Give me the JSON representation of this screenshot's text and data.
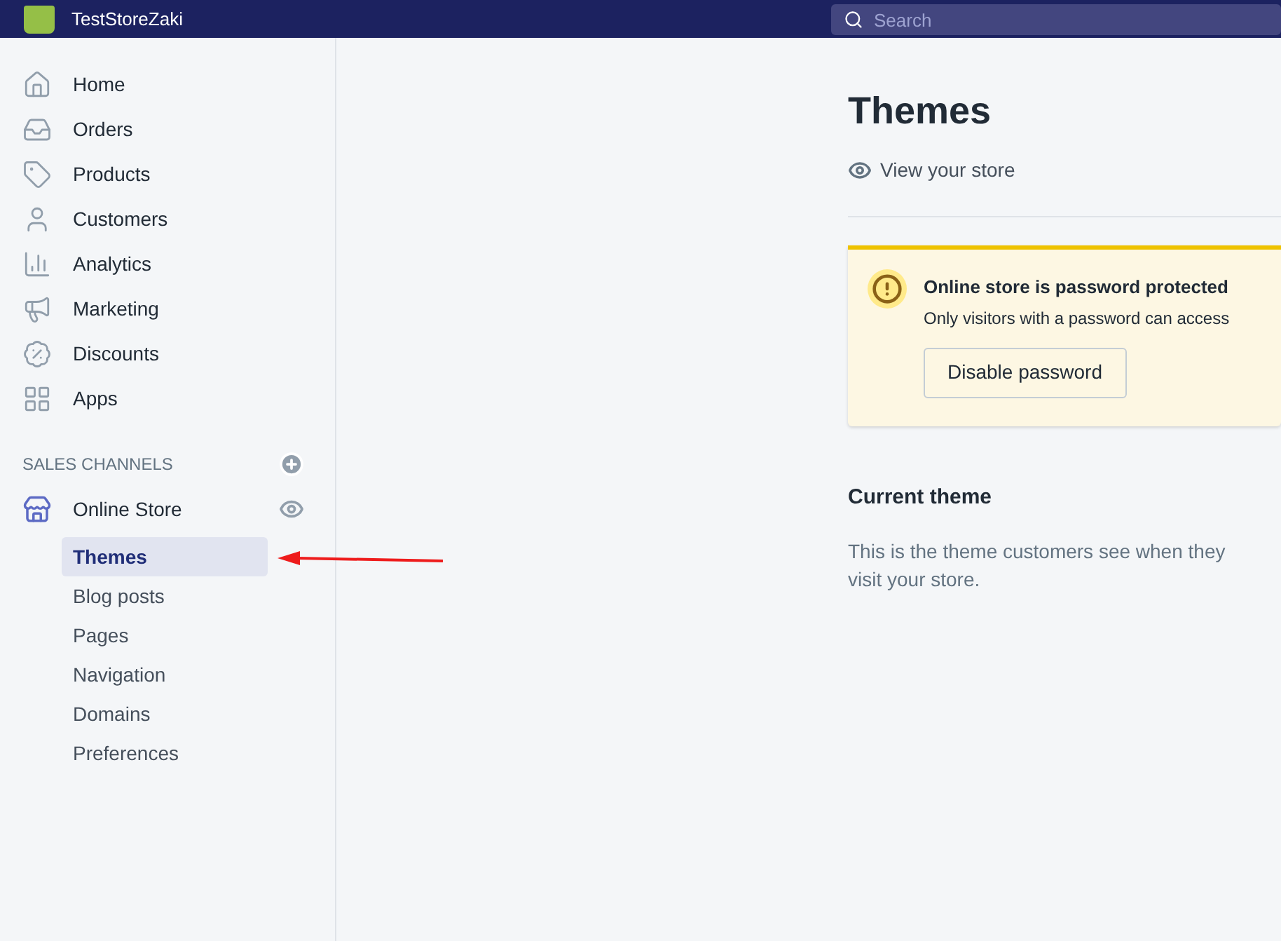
{
  "top_bar": {
    "store_name": "TestStoreZaki",
    "search": {
      "placeholder": "Search"
    }
  },
  "sidebar": {
    "items": [
      {
        "label": "Home",
        "selected": false
      },
      {
        "label": "Orders",
        "selected": false
      },
      {
        "label": "Products",
        "selected": false
      },
      {
        "label": "Customers",
        "selected": false
      },
      {
        "label": "Analytics",
        "selected": false
      },
      {
        "label": "Marketing",
        "selected": false
      },
      {
        "label": "Discounts",
        "selected": false
      },
      {
        "label": "Apps",
        "selected": false
      }
    ],
    "sales_channels": {
      "heading": "SALES CHANNELS",
      "channel": {
        "label": "Online Store",
        "children": [
          {
            "label": "Themes",
            "selected": true
          },
          {
            "label": "Blog posts",
            "selected": false
          },
          {
            "label": "Pages",
            "selected": false
          },
          {
            "label": "Navigation",
            "selected": false
          },
          {
            "label": "Domains",
            "selected": false
          },
          {
            "label": "Preferences",
            "selected": false
          }
        ]
      }
    }
  },
  "main": {
    "title": "Themes",
    "view_link": "View your store",
    "banner": {
      "title": "Online store is password protected",
      "text": "Only visitors with a password can access",
      "button": "Disable password"
    },
    "section": {
      "title": "Current theme",
      "text": "This is the theme customers see when they visit your store."
    }
  }
}
